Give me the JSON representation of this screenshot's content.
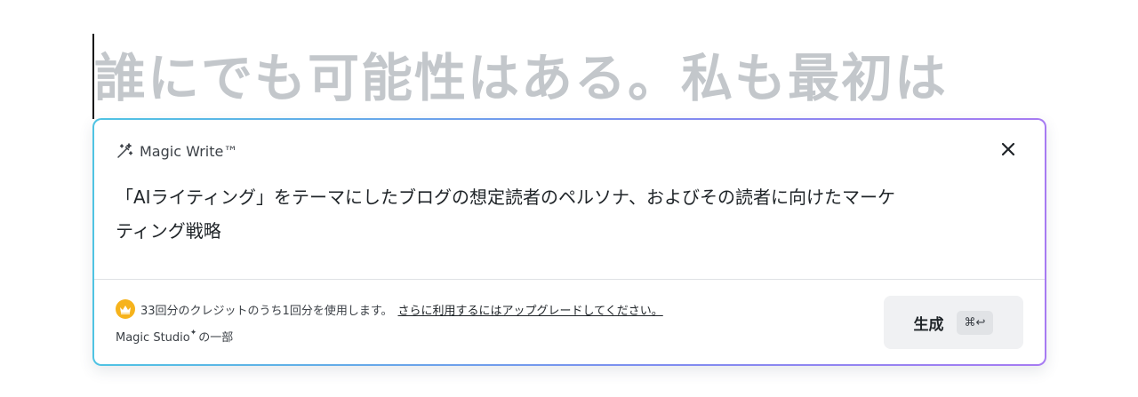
{
  "document": {
    "heading_text": "誰にでも可能性はある。私も最初は"
  },
  "magic_write": {
    "title": "Magic Write™",
    "prompt_line1": "「AIライティング」をテーマにしたブログの想定読者のペルソナ、およびその読者に向けたマーケ",
    "prompt_line2": "ティング戦略",
    "credit_text": "33回分のクレジットのうち1回分を使用します。",
    "upgrade_link": "さらに利用するにはアップグレードしてください。",
    "studio_prefix": "Magic Studio",
    "studio_sparkle": "✦",
    "studio_suffix": "の一部",
    "generate_label": "生成",
    "shortcut_label": "⌘↩"
  },
  "icons": {
    "wand": "magic-wand-icon",
    "close": "close-icon",
    "crown": "crown-icon"
  },
  "colors": {
    "heading_placeholder": "#c3c7cb",
    "gradient_start": "#4fc3e3",
    "gradient_end": "#a77bf2",
    "crown_badge": "#f6b31c",
    "generate_bg": "#f0f1f3"
  }
}
